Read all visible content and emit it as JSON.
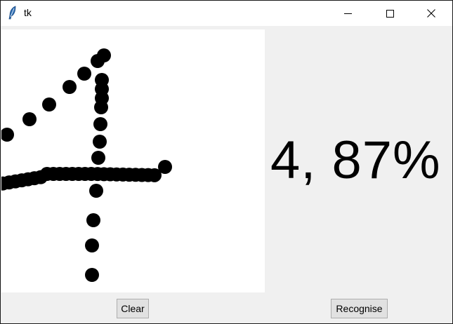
{
  "window": {
    "title": "tk",
    "icons": {
      "app": "tk-feather-icon",
      "minimize": "minimize-icon",
      "maximize": "maximize-icon",
      "close": "close-icon"
    }
  },
  "canvas": {
    "description_color": "#000000",
    "background": "#ffffff"
  },
  "prediction": {
    "text": "4, 87%"
  },
  "buttons": {
    "clear": "Clear",
    "recognise": "Recognise"
  }
}
